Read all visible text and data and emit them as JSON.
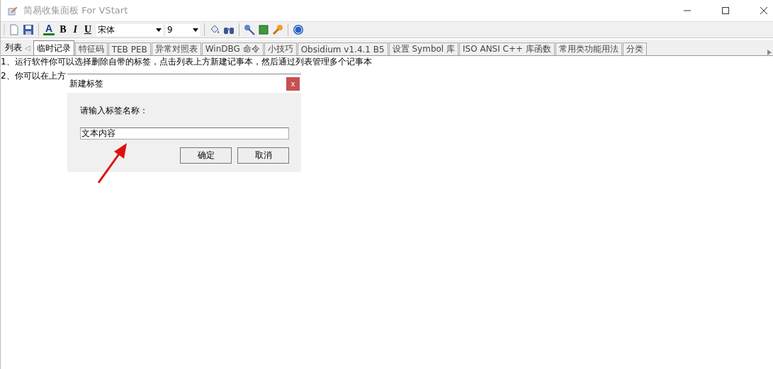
{
  "window": {
    "title": "简易收集面板 For VStart"
  },
  "toolbar": {
    "format_buttons": [
      {
        "label": "A",
        "kind": "color"
      },
      {
        "label": "B",
        "kind": "bold"
      },
      {
        "label": "I",
        "kind": "italic"
      },
      {
        "label": "U",
        "kind": "underline"
      }
    ],
    "font": "宋体",
    "size": "9"
  },
  "tab_strip": {
    "label": "列表",
    "arrow": "◁"
  },
  "tabs": [
    {
      "label": "临时记录",
      "selected": true
    },
    {
      "label": "特征码",
      "selected": false
    },
    {
      "label": "TEB PEB",
      "selected": false
    },
    {
      "label": "异常对照表",
      "selected": false
    },
    {
      "label": "WinDBG 命令",
      "selected": false
    },
    {
      "label": "小技巧",
      "selected": false
    },
    {
      "label": "Obsidium v1.4.1 B5",
      "selected": false
    },
    {
      "label": "设置 Symbol 库",
      "selected": false
    },
    {
      "label": "ISO ANSI C++ 库函数",
      "selected": false
    },
    {
      "label": "常用类功能用法",
      "selected": false
    },
    {
      "label": "分类",
      "selected": false
    }
  ],
  "content_lines": [
    "1、运行软件你可以选择删除自带的标签，点击列表上方新建记事本，然后通过列表管理多个记事本",
    "2、你可以在上方"
  ],
  "dialog": {
    "title": "新建标签",
    "close": "x",
    "prompt": "请输入标签名称：",
    "value": "文本内容",
    "buttons": [
      "确定",
      "取消"
    ]
  }
}
